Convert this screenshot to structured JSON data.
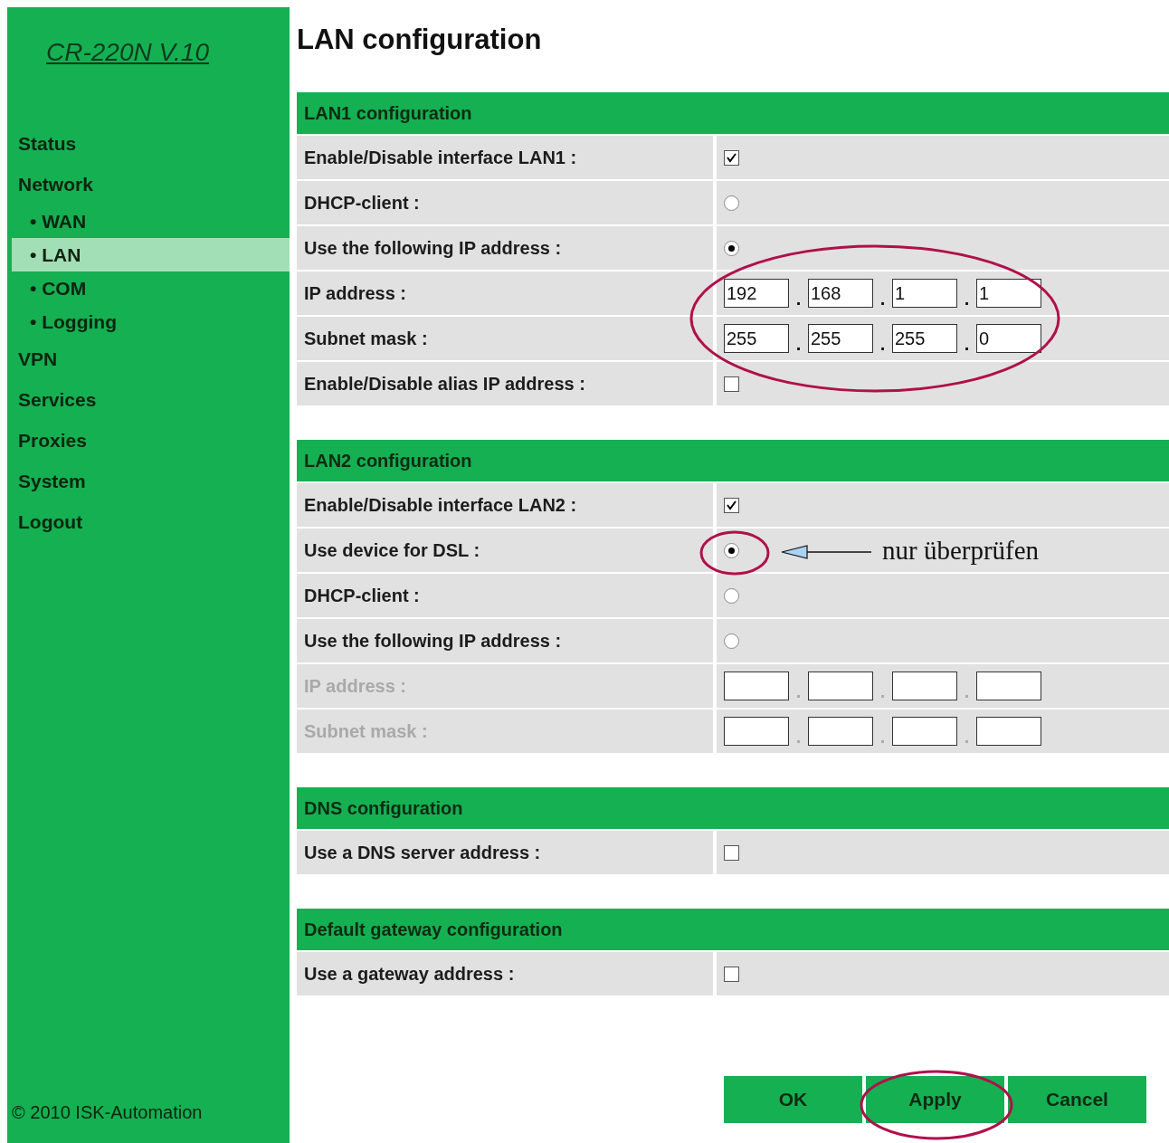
{
  "sidebar": {
    "logo": "CR-220N V.10",
    "items": [
      {
        "label": "Status",
        "selected": false
      },
      {
        "label": "Network",
        "selected": false,
        "children": [
          {
            "label": "WAN",
            "selected": false
          },
          {
            "label": "LAN",
            "selected": true
          },
          {
            "label": "COM",
            "selected": false
          },
          {
            "label": "Logging",
            "selected": false
          }
        ]
      },
      {
        "label": "VPN",
        "selected": false
      },
      {
        "label": "Services",
        "selected": false
      },
      {
        "label": "Proxies",
        "selected": false
      },
      {
        "label": "System",
        "selected": false
      },
      {
        "label": "Logout",
        "selected": false
      }
    ],
    "bullet": "•",
    "footer": "© 2010 ISK-Automation"
  },
  "title": "LAN configuration",
  "sections": [
    {
      "title": "LAN1 configuration",
      "rows": [
        {
          "kind": "checkbox",
          "label": "Enable/Disable interface LAN1 :",
          "checked": true
        },
        {
          "kind": "radio",
          "label": "DHCP-client :",
          "selected": false
        },
        {
          "kind": "radio",
          "label": "Use the following IP address :",
          "selected": true
        },
        {
          "kind": "ip",
          "label": "IP address :",
          "disabled": false,
          "values": [
            "192",
            "168",
            "1",
            "1"
          ]
        },
        {
          "kind": "ip",
          "label": "Subnet mask :",
          "disabled": false,
          "values": [
            "255",
            "255",
            "255",
            "0"
          ]
        },
        {
          "kind": "checkbox",
          "label": "Enable/Disable alias IP address :",
          "checked": false
        }
      ]
    },
    {
      "title": "LAN2 configuration",
      "rows": [
        {
          "kind": "checkbox",
          "label": "Enable/Disable interface LAN2 :",
          "checked": true
        },
        {
          "kind": "radio",
          "label": "Use device for DSL :",
          "selected": true
        },
        {
          "kind": "radio",
          "label": "DHCP-client :",
          "selected": false
        },
        {
          "kind": "radio",
          "label": "Use the following IP address :",
          "selected": false
        },
        {
          "kind": "ip",
          "label": "IP address :",
          "disabled": true
        },
        {
          "kind": "ip",
          "label": "Subnet mask :",
          "disabled": true
        }
      ]
    },
    {
      "title": "DNS configuration",
      "rows": [
        {
          "kind": "checkbox",
          "label": "Use a DNS server address :",
          "checked": false
        }
      ]
    },
    {
      "title": "Default gateway configuration",
      "rows": [
        {
          "kind": "checkbox",
          "label": "Use a gateway address :",
          "checked": false
        }
      ]
    }
  ],
  "buttons": [
    {
      "label": "OK"
    },
    {
      "label": "Apply"
    },
    {
      "label": "Cancel"
    }
  ],
  "ip_separator": ".",
  "annotation": {
    "note": "nur überprüfen"
  }
}
